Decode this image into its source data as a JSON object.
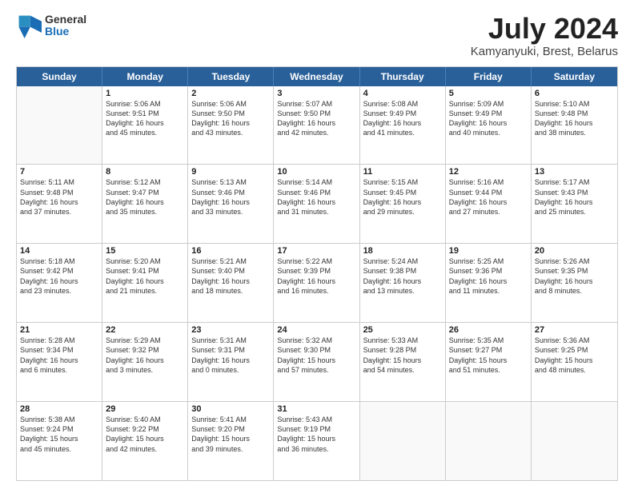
{
  "logo": {
    "general": "General",
    "blue": "Blue"
  },
  "title": {
    "month": "July 2024",
    "location": "Kamyanyuki, Brest, Belarus"
  },
  "header_days": [
    "Sunday",
    "Monday",
    "Tuesday",
    "Wednesday",
    "Thursday",
    "Friday",
    "Saturday"
  ],
  "weeks": [
    [
      {
        "day": "",
        "lines": []
      },
      {
        "day": "1",
        "lines": [
          "Sunrise: 5:06 AM",
          "Sunset: 9:51 PM",
          "Daylight: 16 hours",
          "and 45 minutes."
        ]
      },
      {
        "day": "2",
        "lines": [
          "Sunrise: 5:06 AM",
          "Sunset: 9:50 PM",
          "Daylight: 16 hours",
          "and 43 minutes."
        ]
      },
      {
        "day": "3",
        "lines": [
          "Sunrise: 5:07 AM",
          "Sunset: 9:50 PM",
          "Daylight: 16 hours",
          "and 42 minutes."
        ]
      },
      {
        "day": "4",
        "lines": [
          "Sunrise: 5:08 AM",
          "Sunset: 9:49 PM",
          "Daylight: 16 hours",
          "and 41 minutes."
        ]
      },
      {
        "day": "5",
        "lines": [
          "Sunrise: 5:09 AM",
          "Sunset: 9:49 PM",
          "Daylight: 16 hours",
          "and 40 minutes."
        ]
      },
      {
        "day": "6",
        "lines": [
          "Sunrise: 5:10 AM",
          "Sunset: 9:48 PM",
          "Daylight: 16 hours",
          "and 38 minutes."
        ]
      }
    ],
    [
      {
        "day": "7",
        "lines": [
          "Sunrise: 5:11 AM",
          "Sunset: 9:48 PM",
          "Daylight: 16 hours",
          "and 37 minutes."
        ]
      },
      {
        "day": "8",
        "lines": [
          "Sunrise: 5:12 AM",
          "Sunset: 9:47 PM",
          "Daylight: 16 hours",
          "and 35 minutes."
        ]
      },
      {
        "day": "9",
        "lines": [
          "Sunrise: 5:13 AM",
          "Sunset: 9:46 PM",
          "Daylight: 16 hours",
          "and 33 minutes."
        ]
      },
      {
        "day": "10",
        "lines": [
          "Sunrise: 5:14 AM",
          "Sunset: 9:46 PM",
          "Daylight: 16 hours",
          "and 31 minutes."
        ]
      },
      {
        "day": "11",
        "lines": [
          "Sunrise: 5:15 AM",
          "Sunset: 9:45 PM",
          "Daylight: 16 hours",
          "and 29 minutes."
        ]
      },
      {
        "day": "12",
        "lines": [
          "Sunrise: 5:16 AM",
          "Sunset: 9:44 PM",
          "Daylight: 16 hours",
          "and 27 minutes."
        ]
      },
      {
        "day": "13",
        "lines": [
          "Sunrise: 5:17 AM",
          "Sunset: 9:43 PM",
          "Daylight: 16 hours",
          "and 25 minutes."
        ]
      }
    ],
    [
      {
        "day": "14",
        "lines": [
          "Sunrise: 5:18 AM",
          "Sunset: 9:42 PM",
          "Daylight: 16 hours",
          "and 23 minutes."
        ]
      },
      {
        "day": "15",
        "lines": [
          "Sunrise: 5:20 AM",
          "Sunset: 9:41 PM",
          "Daylight: 16 hours",
          "and 21 minutes."
        ]
      },
      {
        "day": "16",
        "lines": [
          "Sunrise: 5:21 AM",
          "Sunset: 9:40 PM",
          "Daylight: 16 hours",
          "and 18 minutes."
        ]
      },
      {
        "day": "17",
        "lines": [
          "Sunrise: 5:22 AM",
          "Sunset: 9:39 PM",
          "Daylight: 16 hours",
          "and 16 minutes."
        ]
      },
      {
        "day": "18",
        "lines": [
          "Sunrise: 5:24 AM",
          "Sunset: 9:38 PM",
          "Daylight: 16 hours",
          "and 13 minutes."
        ]
      },
      {
        "day": "19",
        "lines": [
          "Sunrise: 5:25 AM",
          "Sunset: 9:36 PM",
          "Daylight: 16 hours",
          "and 11 minutes."
        ]
      },
      {
        "day": "20",
        "lines": [
          "Sunrise: 5:26 AM",
          "Sunset: 9:35 PM",
          "Daylight: 16 hours",
          "and 8 minutes."
        ]
      }
    ],
    [
      {
        "day": "21",
        "lines": [
          "Sunrise: 5:28 AM",
          "Sunset: 9:34 PM",
          "Daylight: 16 hours",
          "and 6 minutes."
        ]
      },
      {
        "day": "22",
        "lines": [
          "Sunrise: 5:29 AM",
          "Sunset: 9:32 PM",
          "Daylight: 16 hours",
          "and 3 minutes."
        ]
      },
      {
        "day": "23",
        "lines": [
          "Sunrise: 5:31 AM",
          "Sunset: 9:31 PM",
          "Daylight: 16 hours",
          "and 0 minutes."
        ]
      },
      {
        "day": "24",
        "lines": [
          "Sunrise: 5:32 AM",
          "Sunset: 9:30 PM",
          "Daylight: 15 hours",
          "and 57 minutes."
        ]
      },
      {
        "day": "25",
        "lines": [
          "Sunrise: 5:33 AM",
          "Sunset: 9:28 PM",
          "Daylight: 15 hours",
          "and 54 minutes."
        ]
      },
      {
        "day": "26",
        "lines": [
          "Sunrise: 5:35 AM",
          "Sunset: 9:27 PM",
          "Daylight: 15 hours",
          "and 51 minutes."
        ]
      },
      {
        "day": "27",
        "lines": [
          "Sunrise: 5:36 AM",
          "Sunset: 9:25 PM",
          "Daylight: 15 hours",
          "and 48 minutes."
        ]
      }
    ],
    [
      {
        "day": "28",
        "lines": [
          "Sunrise: 5:38 AM",
          "Sunset: 9:24 PM",
          "Daylight: 15 hours",
          "and 45 minutes."
        ]
      },
      {
        "day": "29",
        "lines": [
          "Sunrise: 5:40 AM",
          "Sunset: 9:22 PM",
          "Daylight: 15 hours",
          "and 42 minutes."
        ]
      },
      {
        "day": "30",
        "lines": [
          "Sunrise: 5:41 AM",
          "Sunset: 9:20 PM",
          "Daylight: 15 hours",
          "and 39 minutes."
        ]
      },
      {
        "day": "31",
        "lines": [
          "Sunrise: 5:43 AM",
          "Sunset: 9:19 PM",
          "Daylight: 15 hours",
          "and 36 minutes."
        ]
      },
      {
        "day": "",
        "lines": []
      },
      {
        "day": "",
        "lines": []
      },
      {
        "day": "",
        "lines": []
      }
    ]
  ]
}
